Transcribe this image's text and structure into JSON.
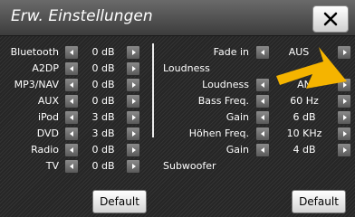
{
  "window": {
    "title": "Erw. Einstellungen"
  },
  "left_panel": {
    "rows": [
      {
        "label": "Bluetooth",
        "value": "0 dB"
      },
      {
        "label": "A2DP",
        "value": "0 dB"
      },
      {
        "label": "MP3/NAV",
        "value": "0 dB"
      },
      {
        "label": "AUX",
        "value": "0 dB"
      },
      {
        "label": "iPod",
        "value": "3 dB"
      },
      {
        "label": "DVD",
        "value": "3 dB"
      },
      {
        "label": "Radio",
        "value": "0 dB"
      },
      {
        "label": "TV",
        "value": "0 dB"
      }
    ],
    "default_button": "Default"
  },
  "right_panel": {
    "fade_in": {
      "label": "Fade in",
      "value": "AUS"
    },
    "loudness_header": "Loudness",
    "loudness": {
      "label": "Loudness",
      "value": "AN"
    },
    "bass_freq": {
      "label": "Bass Freq.",
      "value": "60 Hz"
    },
    "bass_gain": {
      "label": "Gain",
      "value": "6 dB"
    },
    "treble_freq": {
      "label": "Höhen Freq.",
      "value": "10 KHz"
    },
    "treble_gain": {
      "label": "Gain",
      "value": "4 dB"
    },
    "subwoofer_header": "Subwoofer",
    "default_button": "Default"
  },
  "colors": {
    "pointer": "#f5b400"
  },
  "icons": {
    "close": "close-icon",
    "left": "arrow-left-icon",
    "right": "arrow-right-icon"
  }
}
